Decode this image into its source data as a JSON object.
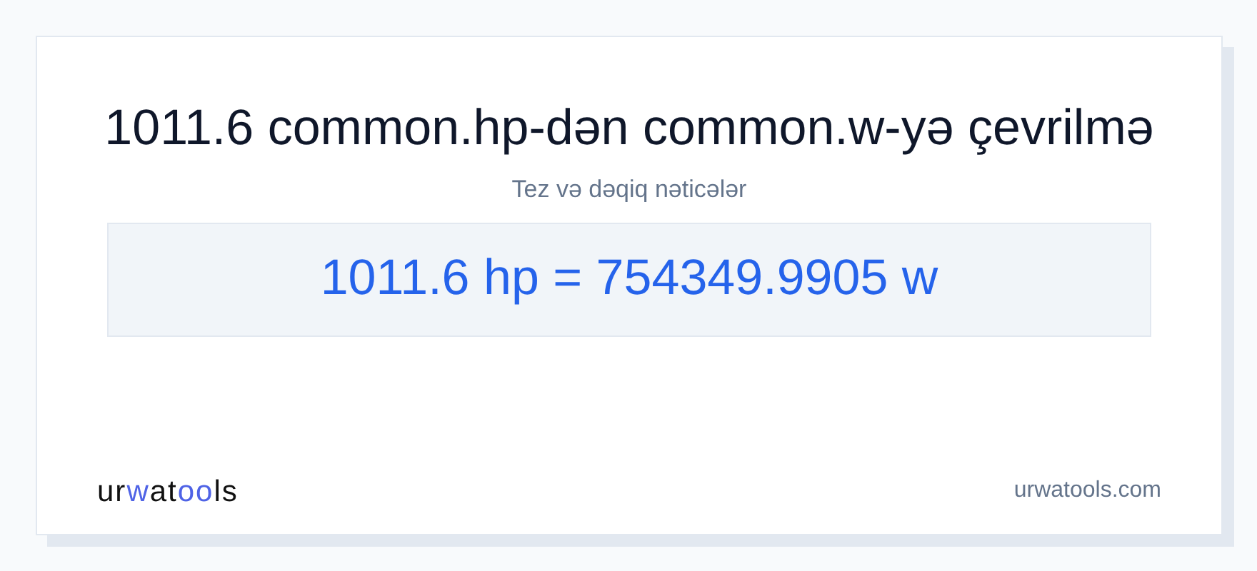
{
  "title": "1011.6 common.hp-dən common.w-yə çevrilmə",
  "subtitle": "Tez və dəqiq nəticələr",
  "result": "1011.6 hp = 754349.9905 w",
  "logo": [
    {
      "text": "ur",
      "highlight": false
    },
    {
      "text": "w",
      "highlight": true
    },
    {
      "text": "at",
      "highlight": false
    },
    {
      "text": "oo",
      "highlight": true
    },
    {
      "text": "ls",
      "highlight": false
    }
  ],
  "site": "urwatools.com"
}
